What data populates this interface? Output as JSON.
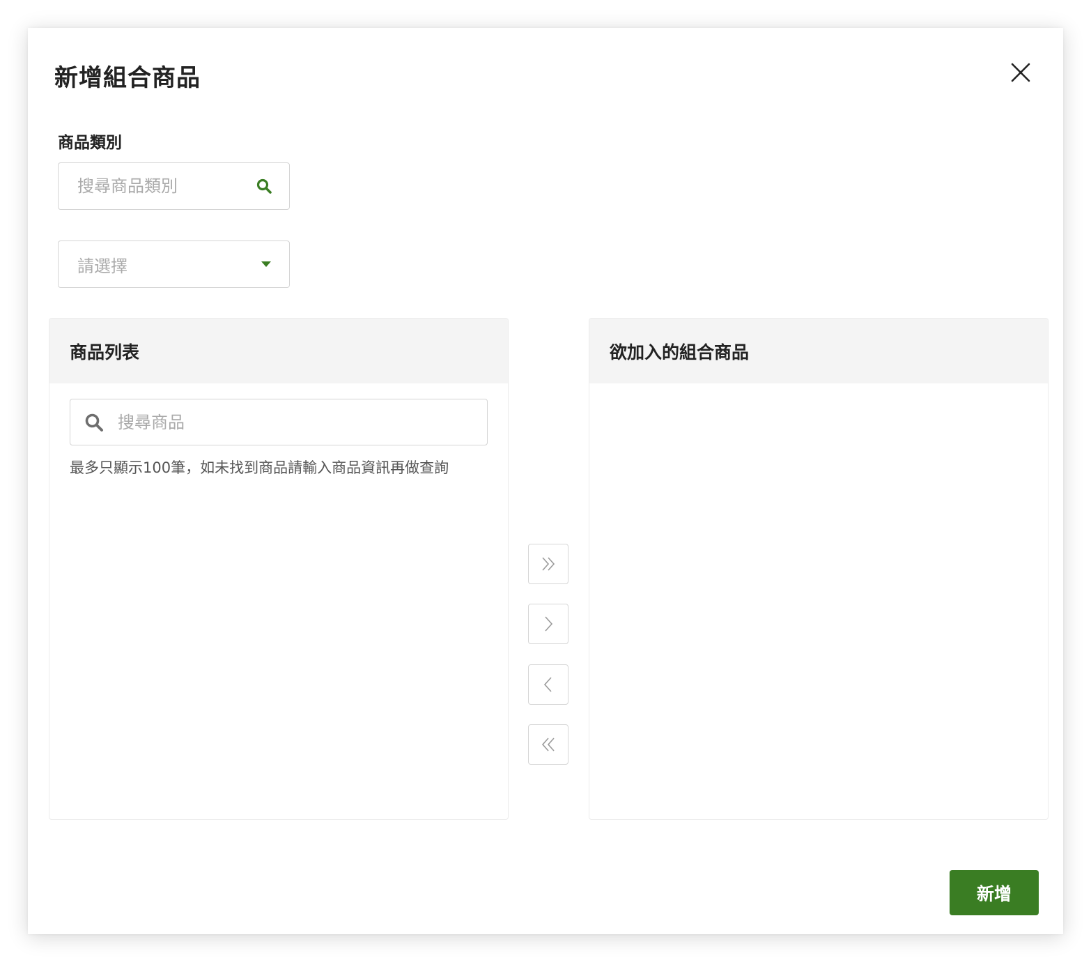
{
  "modal": {
    "title": "新增組合商品"
  },
  "category": {
    "label": "商品類別",
    "search_placeholder": "搜尋商品類別",
    "select_value": "請選擇"
  },
  "product_list": {
    "header": "商品列表",
    "search_placeholder": "搜尋商品",
    "hint": "最多只顯示100筆，如未找到商品請輸入商品資訊再做查詢"
  },
  "selected_list": {
    "header": "欲加入的組合商品"
  },
  "actions": {
    "submit_label": "新增"
  },
  "icons": {
    "close": "close-icon",
    "search": "search-icon",
    "dropdown": "caret-down-icon",
    "move_all_right": "double-chevron-right-icon",
    "move_right": "chevron-right-icon",
    "move_left": "chevron-left-icon",
    "move_all_left": "double-chevron-left-icon"
  },
  "colors": {
    "accent": "#3a7d23",
    "panel_header_bg": "#f4f4f4",
    "border": "#d4d4d4",
    "placeholder": "#aaaaaa"
  }
}
